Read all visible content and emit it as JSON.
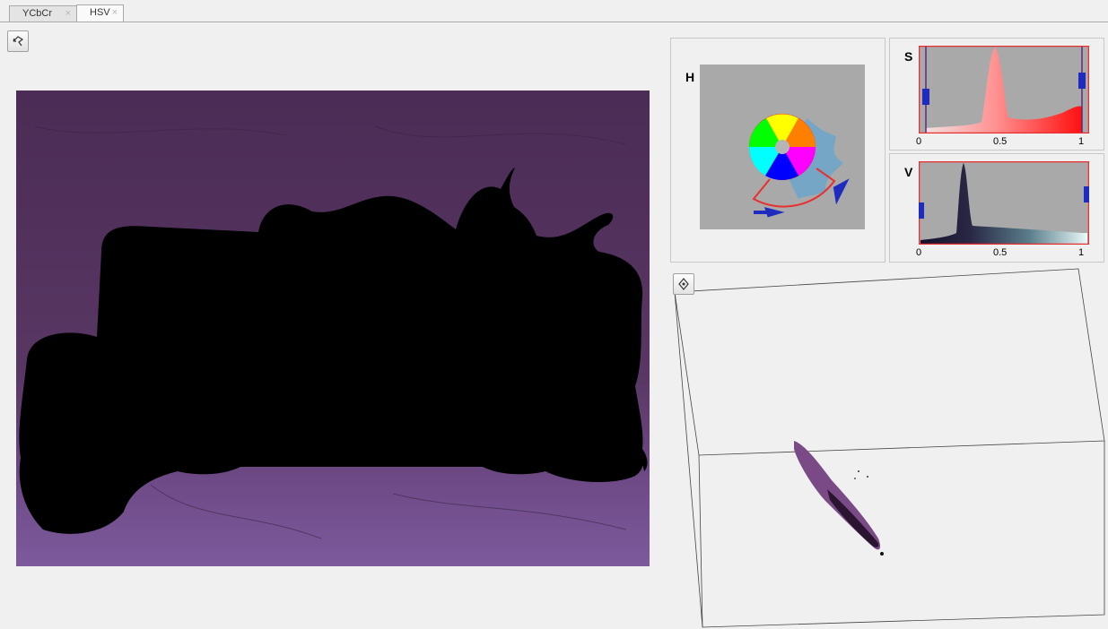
{
  "tabs": [
    {
      "label": "YCbCr",
      "close": "×",
      "active": false
    },
    {
      "label": "HSV",
      "close": "×",
      "active": true
    }
  ],
  "toolbar": {
    "rotate_icon": "rotate-3d-icon"
  },
  "hsv_controls": {
    "hue": {
      "label": "H"
    },
    "saturation": {
      "label": "S",
      "ticks": [
        "0",
        "0.5",
        "1"
      ],
      "range": [
        0.04,
        0.96
      ]
    },
    "value": {
      "label": "V",
      "ticks": [
        "0",
        "0.5",
        "1"
      ],
      "range": [
        0.01,
        0.99
      ]
    }
  },
  "colors": {
    "sat_fill": "#ff6b6b",
    "val_fill_dark": "#1a1633",
    "handle": "#1f2bbf",
    "border_red": "#e83030",
    "background_cloth": "#5a3866",
    "plot_points": "#7a4a86"
  }
}
